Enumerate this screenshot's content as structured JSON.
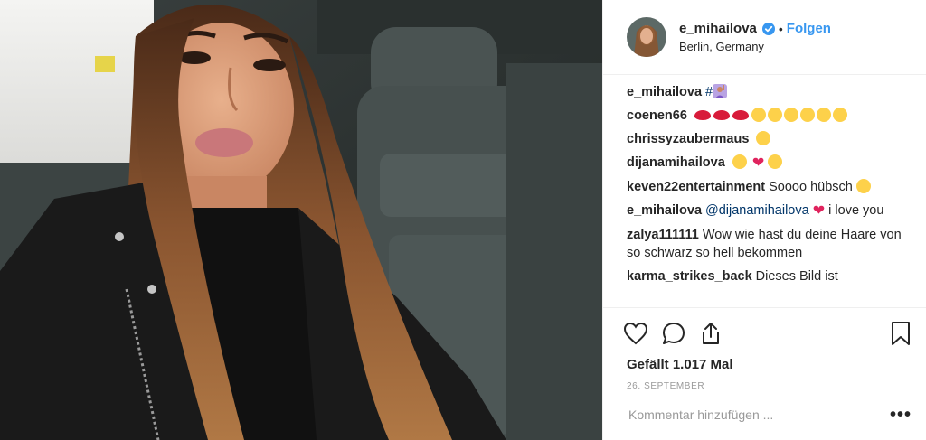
{
  "post": {
    "author": {
      "username": "e_mihailova",
      "verified": true,
      "follow_label": "Folgen",
      "location": "Berlin, Germany"
    },
    "comments": [
      {
        "user": "e_mihailova",
        "text": "#",
        "emojis": [
          "woman-raising-hand"
        ]
      },
      {
        "user": "coenen66",
        "text": "",
        "emojis": [
          "lips",
          "lips",
          "lips",
          "heart-eyes",
          "heart-eyes",
          "heart-eyes",
          "kiss-wink",
          "kiss-wink",
          "kiss-wink"
        ]
      },
      {
        "user": "chrissyzaubermaus",
        "text": "",
        "emojis": [
          "heart-eyes"
        ]
      },
      {
        "user": "dijanamihailova",
        "text": "",
        "emojis": [
          "heart-eyes",
          "red-heart",
          "kiss-wink"
        ]
      },
      {
        "user": "keven22entertainment",
        "text": "Soooo hübsch",
        "emojis": [
          "smile"
        ]
      },
      {
        "user": "e_mihailova",
        "mention": "@dijanamihailova",
        "text": "i love you",
        "emojis": [
          "red-heart"
        ]
      },
      {
        "user": "zalya111111",
        "text": "Wow wie hast du deine Haare von so schwarz so hell bekommen",
        "emojis": []
      },
      {
        "user": "karma_strikes_back",
        "text": "Dieses Bild ist",
        "emojis": []
      }
    ],
    "likes_text": "Gefällt 1.017 Mal",
    "date": "26. SEPTEMBER",
    "comment_placeholder": "Kommentar hinzufügen ...",
    "more_label": "•••"
  },
  "icons": {
    "like": "heart-outline-icon",
    "comment": "comment-bubble-icon",
    "share": "share-icon",
    "save": "bookmark-icon",
    "verified": "verified-badge-icon",
    "more": "more-dots-icon"
  },
  "colors": {
    "link": "#3897f0",
    "verified": "#3897f0",
    "text": "#262626",
    "muted": "#999999",
    "divider": "#efefef"
  }
}
